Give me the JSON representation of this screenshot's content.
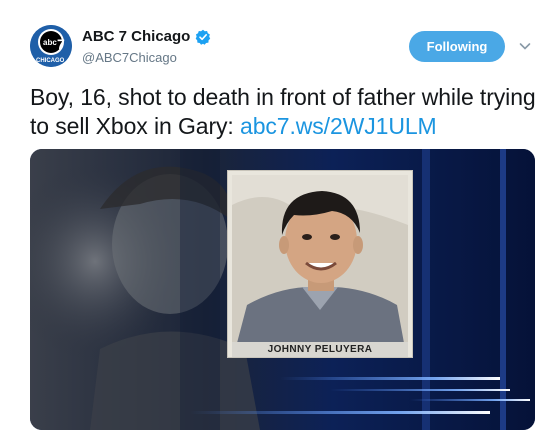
{
  "account": {
    "display_name": "ABC 7 Chicago",
    "handle": "@ABC7Chicago",
    "avatar_logo_text": "abc7",
    "avatar_subtext": "CHICAGO",
    "verified_icon": "verified-badge-icon"
  },
  "actions": {
    "follow_label": "Following",
    "menu_icon": "chevron-down-icon"
  },
  "tweet": {
    "text_before_link": "Boy, 16, shot to death in front of father while trying to sell Xbox in Gary: ",
    "link_text": "abc7.ws/2WJ1ULM"
  },
  "media": {
    "caption": "JOHNNY PELUYERA"
  },
  "colors": {
    "accent": "#1b95e0",
    "follow_bg": "#4aa8e6",
    "media_bg": "#0b1d4a"
  }
}
